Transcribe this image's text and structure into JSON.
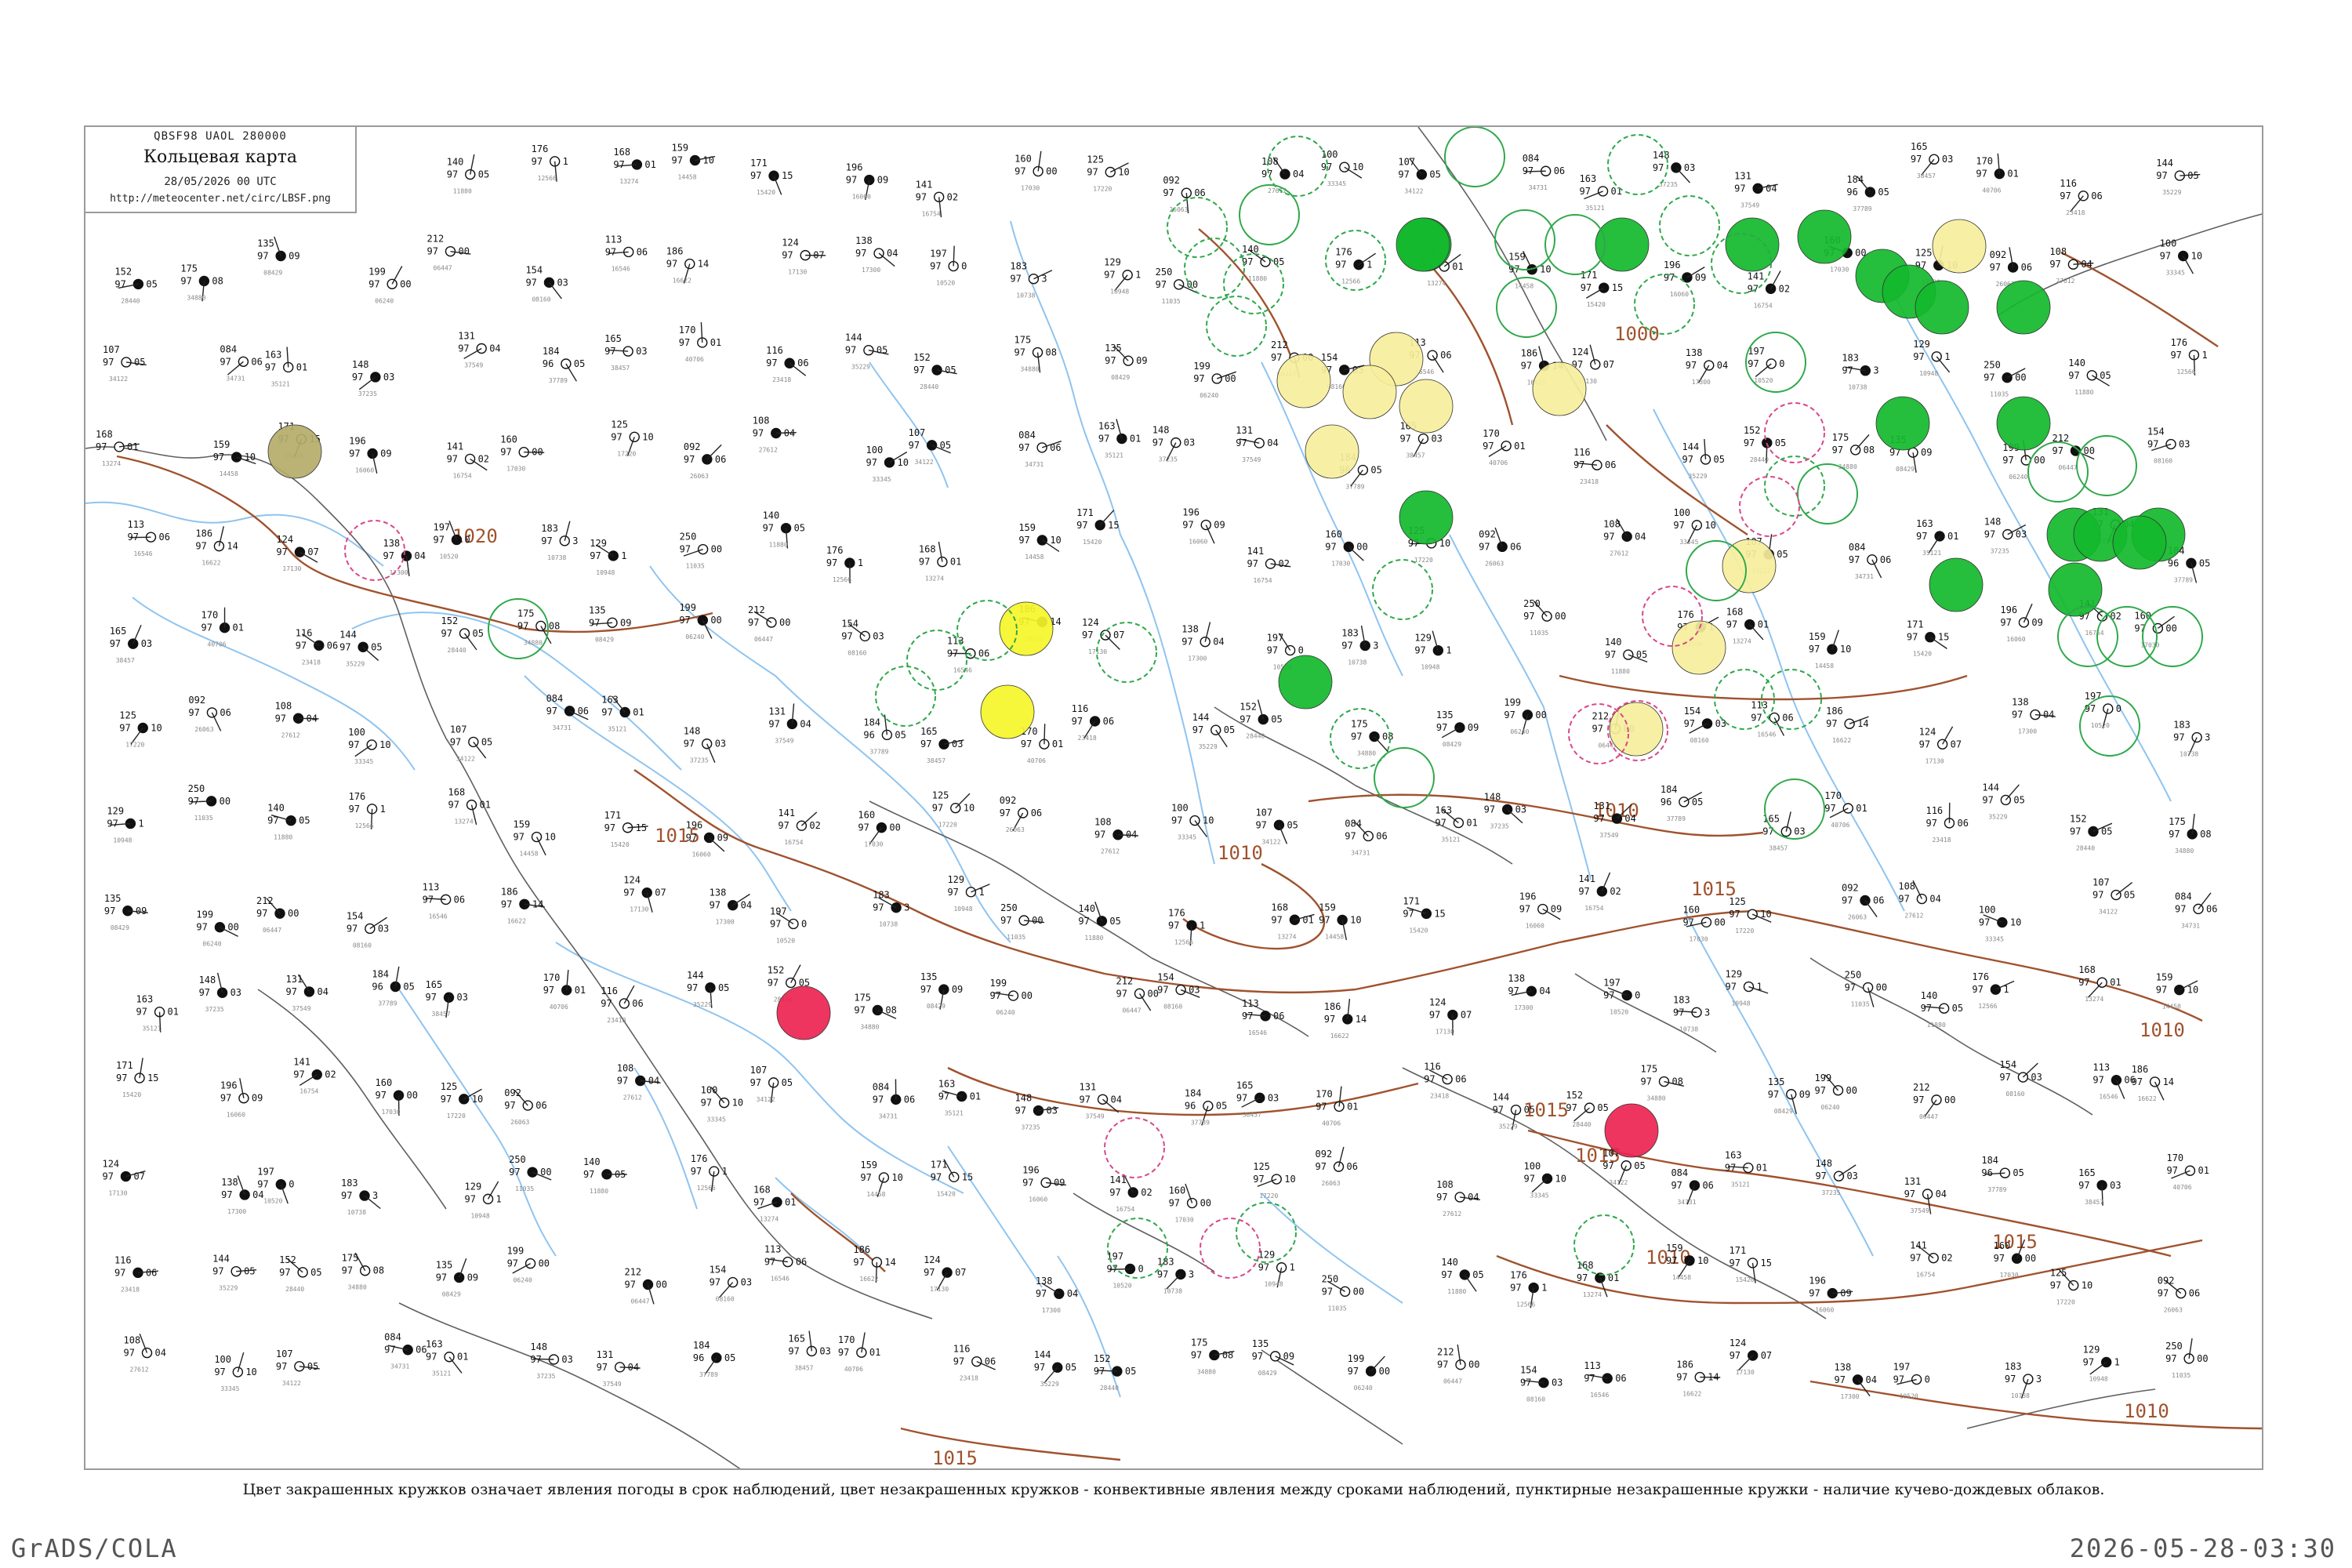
{
  "header": {
    "code": "QBSF98  UAOL  280000",
    "title": "Кольцевая карта",
    "date": "28/05/2026 00 UTC",
    "url": "http://meteocenter.net/circ/LBSF.png"
  },
  "caption": "Цвет закрашенных кружков означает явления погоды в срок наблюдений, цвет незакрашенных кружков - конвективные явления между сроками наблюдений, пунктирные незакрашенные кружки - наличие кучево-дождевых облаков.",
  "footer": {
    "left": "GrADS/COLA",
    "right": "2026-05-28-03:30"
  },
  "colors": {
    "frame": "#9a9a9a",
    "isobar": "#a0522d",
    "water": "#8fc4ef",
    "rain_fill": "#12b82c",
    "drizzle_fill": "#f5f52a",
    "haze_fill": "#f6ef9c",
    "thunder_fill": "#ec2453",
    "fog_fill": "#b5ad6a",
    "cb_ring": "#2ea84a",
    "thunder_ring": "#d8478a"
  },
  "isobars": [
    {
      "label": "1020"
    },
    {
      "label": "1015"
    },
    {
      "label": "1010"
    },
    {
      "label": "1000"
    }
  ],
  "stations": [
    {
      "p": "197",
      "t": "97",
      "d": "0",
      "id": "10520"
    },
    {
      "p": "183",
      "t": "97",
      "d": "3",
      "id": "10738"
    },
    {
      "p": "129",
      "t": "97",
      "d": "1",
      "id": "10948"
    },
    {
      "p": "250",
      "t": "97",
      "d": "00",
      "id": "11035"
    },
    {
      "p": "140",
      "t": "97",
      "d": "05",
      "id": "11880"
    },
    {
      "p": "176",
      "t": "97",
      "d": "1",
      "id": "12566"
    },
    {
      "p": "168",
      "t": "97",
      "d": "01",
      "id": "13274"
    },
    {
      "p": "159",
      "t": "97",
      "d": "10",
      "id": "14458"
    },
    {
      "p": "171",
      "t": "97",
      "d": "15",
      "id": "15420"
    },
    {
      "p": "196",
      "t": "97",
      "d": "09",
      "id": "16060"
    },
    {
      "p": "141",
      "t": "97",
      "d": "02",
      "id": "16754"
    },
    {
      "p": "160",
      "t": "97",
      "d": "00",
      "id": "17030"
    },
    {
      "p": "125",
      "t": "97",
      "d": "10",
      "id": "17220"
    },
    {
      "p": "092",
      "t": "97",
      "d": "06",
      "id": "26063"
    },
    {
      "p": "108",
      "t": "97",
      "d": "04",
      "id": "27612"
    },
    {
      "p": "100",
      "t": "97",
      "d": "10",
      "id": "33345"
    },
    {
      "p": "107",
      "t": "97",
      "d": "05",
      "id": "34122"
    },
    {
      "p": "084",
      "t": "97",
      "d": "06",
      "id": "34731"
    },
    {
      "p": "163",
      "t": "97",
      "d": "01",
      "id": "35121"
    },
    {
      "p": "148",
      "t": "97",
      "d": "03",
      "id": "37235"
    },
    {
      "p": "131",
      "t": "97",
      "d": "04",
      "id": "37549"
    },
    {
      "p": "184",
      "t": "96",
      "d": "05",
      "id": "37789"
    },
    {
      "p": "165",
      "t": "97",
      "d": "03",
      "id": "38457"
    },
    {
      "p": "170",
      "t": "97",
      "d": "01",
      "id": "40706"
    },
    {
      "p": "116",
      "t": "97",
      "d": "06",
      "id": "23418"
    },
    {
      "p": "144",
      "t": "97",
      "d": "05",
      "id": "35229"
    },
    {
      "p": "152",
      "t": "97",
      "d": "05",
      "id": "28440"
    },
    {
      "p": "175",
      "t": "97",
      "d": "08",
      "id": "34880"
    },
    {
      "p": "135",
      "t": "97",
      "d": "09",
      "id": "08429"
    },
    {
      "p": "199",
      "t": "97",
      "d": "00",
      "id": "06240"
    },
    {
      "p": "212",
      "t": "97",
      "d": "00",
      "id": "06447"
    },
    {
      "p": "154",
      "t": "97",
      "d": "03",
      "id": "08160"
    },
    {
      "p": "113",
      "t": "97",
      "d": "06",
      "id": "16546"
    },
    {
      "p": "186",
      "t": "97",
      "d": "14",
      "id": "16622"
    },
    {
      "p": "124",
      "t": "97",
      "d": "07",
      "id": "17130"
    },
    {
      "p": "138",
      "t": "97",
      "d": "04",
      "id": "17300"
    }
  ]
}
